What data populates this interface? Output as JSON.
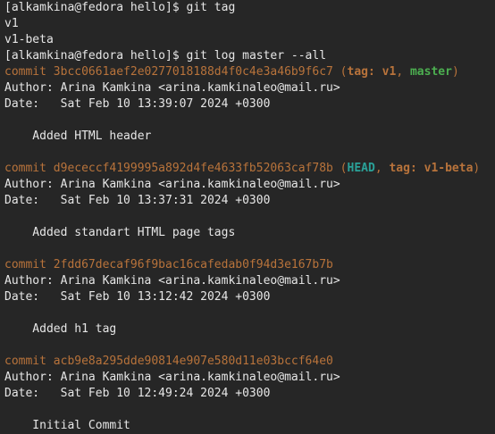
{
  "prompt": "[alkamkina@fedora hello]$ ",
  "commands": {
    "git_tag": "git tag",
    "git_log": "git log master --all"
  },
  "tags": [
    "v1",
    "v1-beta"
  ],
  "commits": [
    {
      "hash": "commit 3bcc0661aef2e0277018188d4f0c4e3a46b9f6c7",
      "decoration": {
        "open": " (",
        "items": [
          {
            "text": "tag: v1",
            "color": "#b8733b",
            "bold": true
          },
          {
            "sep": ", "
          },
          {
            "text": "master",
            "color": "#4caf50",
            "bold": true
          }
        ],
        "close": ")"
      },
      "author": "Author: Arina Kamkina <arina.kamkinaleo@mail.ru>",
      "date": "Date:   Sat Feb 10 13:39:07 2024 +0300",
      "message": "    Added HTML header"
    },
    {
      "hash": "commit d9ececcf4199995a892d4fe4633fb52063caf78b",
      "decoration": {
        "open": " (",
        "items": [
          {
            "text": "HEAD",
            "color": "#2aa198",
            "bold": true
          },
          {
            "sep": ", "
          },
          {
            "text": "tag: v1-beta",
            "color": "#b8733b",
            "bold": true
          }
        ],
        "close": ")"
      },
      "author": "Author: Arina Kamkina <arina.kamkinaleo@mail.ru>",
      "date": "Date:   Sat Feb 10 13:37:31 2024 +0300",
      "message": "    Added standart HTML page tags"
    },
    {
      "hash": "commit 2fdd67decaf96f9bac16cafedab0f94d3e167b7b",
      "decoration": null,
      "author": "Author: Arina Kamkina <arina.kamkinaleo@mail.ru>",
      "date": "Date:   Sat Feb 10 13:12:42 2024 +0300",
      "message": "    Added h1 tag"
    },
    {
      "hash": "commit acb9e8a295dde90814e907e580d11e03bccf64e0",
      "decoration": null,
      "author": "Author: Arina Kamkina <arina.kamkinaleo@mail.ru>",
      "date": "Date:   Sat Feb 10 12:49:24 2024 +0300",
      "message": "    Initial Commit"
    }
  ],
  "colors": {
    "background": "#262626",
    "text": "#e6e6e6",
    "commit_hash": "#b8733b",
    "head": "#2aa198",
    "branch": "#4caf50"
  }
}
